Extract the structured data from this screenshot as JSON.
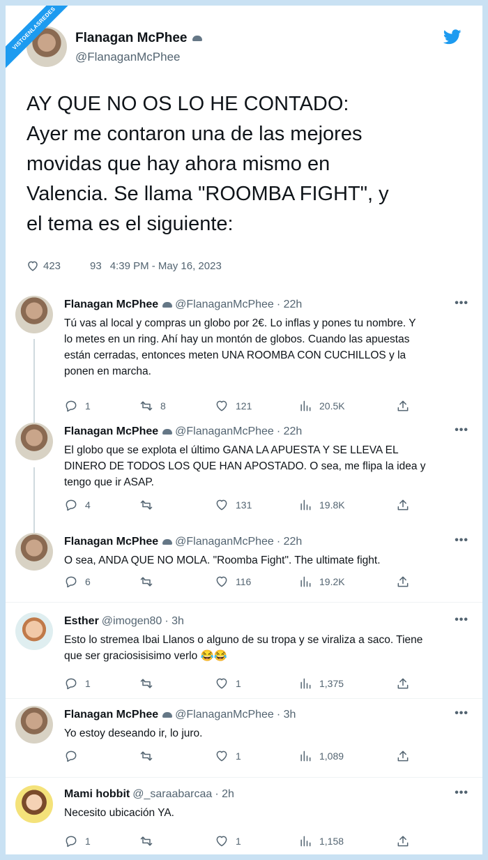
{
  "watermark": "VISTOENLASREDES",
  "main_tweet": {
    "name": "Flanagan McPhee",
    "handle": "@FlanaganMcPhee",
    "text_lines": [
      "AY QUE NO OS LO HE CONTADO:",
      "Ayer me contaron una de las mejores",
      "movidas que hay ahora mismo en",
      "Valencia. Se llama \"ROOMBA FIGHT\", y",
      "el tema es el siguiente:"
    ],
    "likes": "423",
    "retweets": "93",
    "timestamp": "4:39 PM - May 16, 2023"
  },
  "replies": [
    {
      "name": "Flanagan McPhee",
      "handle": "@FlanaganMcPhee",
      "time": "· 22h",
      "lines": [
        "Tú vas al local y compras un globo por 2€. Lo inflas y pones tu nombre. Y",
        "lo metes en un ring. Ahí hay un montón de globos. Cuando las apuestas",
        "están cerradas, entonces meten UNA ROOMBA CON CUCHILLOS y la",
        "ponen en marcha."
      ],
      "replies": "1",
      "retweets": "8",
      "likes": "121",
      "views": "20.5K"
    },
    {
      "name": "Flanagan McPhee",
      "handle": "@FlanaganMcPhee",
      "time": "· 22h",
      "lines": [
        "El globo que se explota el último GANA LA APUESTA Y SE LLEVA EL",
        "DINERO DE TODOS LOS QUE HAN APOSTADO. O sea, me flipa la idea y",
        "tengo que ir ASAP."
      ],
      "replies": "4",
      "retweets": "",
      "likes": "131",
      "views": "19.8K"
    },
    {
      "name": "Flanagan McPhee",
      "handle": "@FlanaganMcPhee",
      "time": "· 22h",
      "lines": [
        "O sea, ANDA QUE NO MOLA. \"Roomba Fight\". The ultimate fight."
      ],
      "replies": "6",
      "retweets": "",
      "likes": "116",
      "views": "19.2K"
    },
    {
      "name": "Esther",
      "handle": "@imogen80",
      "time": "· 3h",
      "lines": [
        "Esto lo stremea Ibai Llanos o alguno de su tropa y se viraliza a saco. Tiene",
        "que ser graciosisisimo verlo 😂😂"
      ],
      "replies": "1",
      "retweets": "",
      "likes": "1",
      "views": "1,375"
    },
    {
      "name": "Flanagan McPhee",
      "handle": "@FlanaganMcPhee",
      "time": "· 3h",
      "lines": [
        "Yo estoy deseando ir, lo juro."
      ],
      "replies": "",
      "retweets": "",
      "likes": "1",
      "views": "1,089"
    },
    {
      "name": "Mami hobbit",
      "handle": "@_saraabarcaa",
      "time": "· 2h",
      "lines": [
        "Necesito ubicación YA."
      ],
      "replies": "1",
      "retweets": "",
      "likes": "1",
      "views": "1,158"
    }
  ],
  "more_label": "•••",
  "colors": {
    "twitter_blue": "#1d9bf0",
    "muted": "#536471"
  }
}
